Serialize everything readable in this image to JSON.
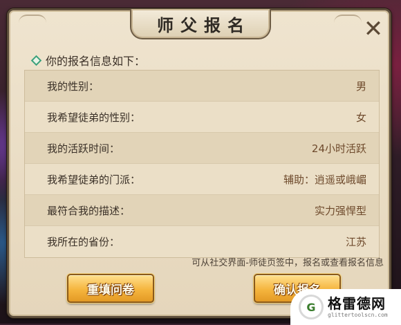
{
  "dialog": {
    "title": "师父报名",
    "close_symbol": "✕",
    "header": "你的报名信息如下：",
    "rows": [
      {
        "label": "我的性别：",
        "value": "男"
      },
      {
        "label": "我希望徒弟的性别：",
        "value": "女"
      },
      {
        "label": "我的活跃时间：",
        "value": "24小时活跃"
      },
      {
        "label": "我希望徒弟的门派：",
        "value": "辅助：逍遥或峨嵋"
      },
      {
        "label": "最符合我的描述：",
        "value": "实力强悍型"
      },
      {
        "label": "我所在的省份：",
        "value": "江苏"
      }
    ],
    "hint": "可从社交界面-师徒页签中，报名或查看报名信息",
    "buttons": {
      "refill": "重填问卷",
      "confirm": "确认报名"
    }
  },
  "watermark": {
    "logo_letter": "G",
    "title": "格雷德网",
    "url": "glittertoolscn.com"
  },
  "icons": {
    "header_bullet": "diamond-icon",
    "close": "close-icon"
  },
  "colors": {
    "panel_bg": "#efe4cf",
    "button_gold": "#f5b53e",
    "value_text": "#6e4a2c",
    "bullet_green": "#3aa07a"
  }
}
